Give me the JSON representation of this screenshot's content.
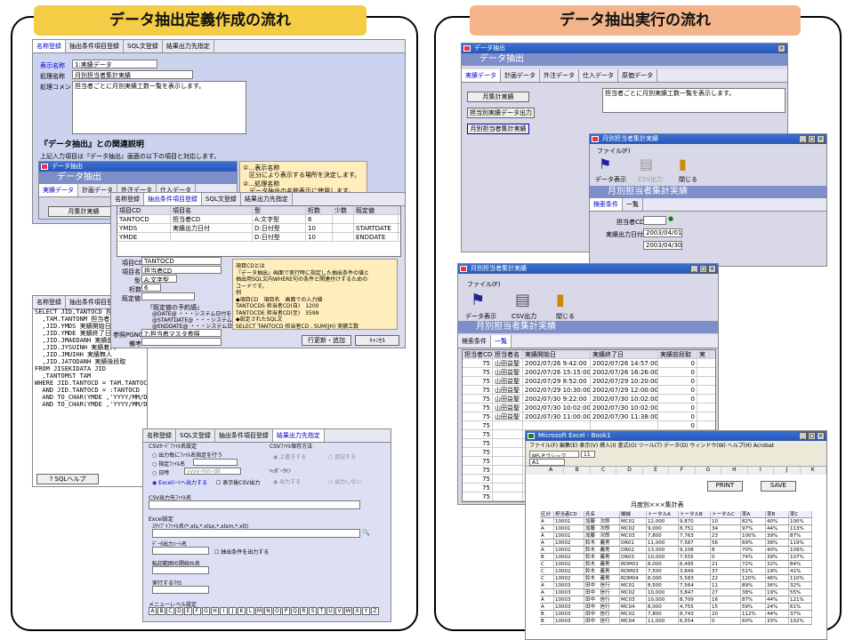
{
  "left": {
    "title": "データ抽出定義作成の流れ"
  },
  "right": {
    "title": "データ抽出実行の流れ"
  },
  "w1": {
    "tabs": [
      "名称登録",
      "抽出条件項目登録",
      "SQL文登録",
      "結果出力先指定"
    ],
    "display_label": "表示名称",
    "display_value": "1:実績データ",
    "process_label": "処理名称",
    "process_value": "月別担当者集計実績",
    "comment_label": "処理コメント",
    "comment_value": "担当者ごとに月別実績工数一覧を表示します。"
  },
  "rel": {
    "heading": "『データ抽出』との関連説明",
    "desc": "上記入力項目は『データ抽出』画面の以下の項目と対応します。",
    "mini_title": "データ抽出",
    "mini_header": "データ抽出",
    "mini_tabs": [
      "実績データ",
      "計画データ",
      "外注データ",
      "仕入データ",
      "原価データ"
    ],
    "mini_btn": "月集計実績",
    "note1": "①…表示名称",
    "note1b": "区分により表示する場所を決定します。",
    "note2": "②…処理名称",
    "note2b": "データ抽出の名称表示に使用します。"
  },
  "w2": {
    "tabs": [
      "名称登録",
      "抽出条件項目登録",
      "SQL文登録",
      "結果出力先指定"
    ],
    "cols": [
      "項目CD",
      "項目名",
      "型",
      "桁数",
      "少数",
      "既定値"
    ],
    "rows": [
      [
        "TANTOCD",
        "担当者CD",
        "A:文字型",
        "6",
        "",
        ""
      ],
      [
        "YMDS",
        "実績出力日付",
        "D:日付型",
        "10",
        "",
        "STARTDATE"
      ],
      [
        "YMDE",
        "",
        "D:日付型",
        "10",
        "",
        "ENDDATE"
      ]
    ],
    "code_label": "項目CD",
    "code_value": "TANTOCD",
    "name_label": "項目名",
    "name_value": "担当者CD",
    "type_label": "型",
    "type_value": "A:文字型",
    "digits_label": "桁数",
    "digits_value": "6",
    "default_label": "既定値",
    "hint_title": "『既定値の予約語』",
    "hint_lines": [
      "@DATE@ ・・・システム日付を表示",
      "@STARTDATE@ ・・・システム日付の月初",
      "@ENDDATE@ ・・・システム日付の月末"
    ],
    "ref_label": "参照PGNO",
    "ref_value": "7:担当者マスタ参照",
    "note_label": "備考",
    "note_lines": [
      "項目CDとは",
      "『データ抽出』画面で実行時に指定した抽出条件の値と",
      "抽出用SQL文内WHERE句の条件と関連付けするための",
      "コードです。",
      "例",
      "◆項目CD　項目名　画面での入力値",
      "TANTOCDS 担当者CD(自)　1200",
      "TANTOCDE 担当者CD(至)　3599",
      "◆設定されたSQL文",
      "SELECT TANTOCD 担当者CD , SUM(JH) 実績工数"
    ],
    "btn_add": "行更新・追加",
    "btn_cancel": "ｷｬﾝｾﾙ"
  },
  "w3": {
    "tabs": [
      "名称登録",
      "抽出条件項目登録"
    ],
    "sql": [
      "SELECT JID,TANTOCD 担当者CD",
      "  ,TAM.TANTONM 担当者名",
      "  ,JID.YMDS 実績開始日",
      "  ,JID.YMDE 実績終了日",
      "  ,JID.JMAEDANH 実績前段取",
      "  ,JID.JYSUINH 実績着入",
      "  ,JID.JMUIHH 実績無人",
      "  ,JID.JATODANH 実績後段取",
      "FROM JISEKIDATA JID",
      "  ,TANTOMST TAM",
      "WHERE JID.TANTOCD = TAM.TANTOCD (+)",
      "  AND JID.TANTOCD = :TANTOCD",
      "  AND TO_CHAR(YMDE ,'YYYY/MM/DD') >= :YMDS",
      "  AND TO_CHAR(YMDE ,'YYYY/MM/DD') <= :YMDE"
    ],
    "help": "SQLヘルプ"
  },
  "w4": {
    "tabs": [
      "名称登録",
      "SQL文登録",
      "抽出条件項目登録",
      "結果出力先指定"
    ],
    "grp1": "CSVｶｰﾄﾞﾌｧｲﾙ名設定",
    "opt1": "出力毎にﾌｧｲﾙ名指定を行う",
    "opt2": "指定ﾌｧｲﾙ名",
    "opt3": "日時",
    "date_fmt": "yyyy-mm-dd",
    "opt4": "Excelｼｰﾄへ出力する",
    "chk1": "表示後CSV出力",
    "grp2": "CSVﾌｧｲﾙ保存方法",
    "save1": "上書きする",
    "save2": "追記する",
    "grp3": "ﾍｯﾀﾞｰﾗｲﾝ",
    "hdr1": "出力する",
    "hdr2": "出力しない",
    "csv_file": "CSV出力先ﾌｧｲﾙ名",
    "excel_grp": "Excel設定",
    "excel_file": "ｽｸﾘﾌﾟﾄﾌｧｲﾙ名(*.xls,*.xlsx,*.xlsm,*.xlt)",
    "sheet": "ﾃﾞｰﾀ出力ｼｰﾄ名",
    "chk2": "抽出条件を出力する",
    "range": "転記範囲の開始ｾﾙ名",
    "macro": "実行するﾏｸﾛ",
    "menu": "メニューレベル設定",
    "letters": [
      "A",
      "B",
      "C",
      "D",
      "E",
      "F",
      "G",
      "H",
      "I",
      "J",
      "K",
      "L",
      "M",
      "N",
      "O",
      "P",
      "Q",
      "R",
      "S",
      "T",
      "U",
      "V",
      "W",
      "X",
      "Y",
      "Z"
    ]
  },
  "r1": {
    "title": "データ抽出",
    "header": "データ抽出",
    "tabs": [
      "実績データ",
      "計画データ",
      "外注データ",
      "仕入データ",
      "原価データ"
    ],
    "btns": [
      "月集計実績",
      "担当別実績データ出力",
      "月別担当者集計実績"
    ],
    "desc": "担当者ごとに月別実績工数一覧を表示します。"
  },
  "r2": {
    "title": "月別担当者集計実績",
    "menu": "ファイル(F)",
    "btns": [
      "データ表示",
      "CSV出力",
      "閉じる"
    ],
    "header": "月別担当者集計実績",
    "tabs": [
      "検索条件",
      "一覧"
    ],
    "tanto_label": "担当者CD",
    "date_label": "実績出力日付",
    "date_from": "2003/04/01",
    "date_to": "2003/04/30"
  },
  "r3": {
    "title": "月別担当者集計実績",
    "menu": "ファイル(F)",
    "btns": [
      "データ表示",
      "CSV出力",
      "閉じる"
    ],
    "header": "月別担当者集計実績",
    "tabs": [
      "検索条件",
      "一覧"
    ],
    "cols": [
      "担当者CD",
      "担当者名",
      "実績開始日",
      "実績終了日",
      "実績前段取",
      "実"
    ],
    "rows": [
      [
        "75",
        "山田益聖",
        "2002/07/26 9:42:00",
        "2002/07/26 14:57:00",
        "0"
      ],
      [
        "75",
        "山田益聖",
        "2002/07/26 15:15:00",
        "2002/07/26 16:26:00",
        "0"
      ],
      [
        "75",
        "山田益聖",
        "2002/07/29 8:52:00",
        "2002/07/29 10:20:00",
        "0"
      ],
      [
        "75",
        "山田益聖",
        "2002/07/29 10:30:00",
        "2002/07/29 12:00:00",
        "0"
      ],
      [
        "75",
        "山田益聖",
        "2002/07/30 9:22:00",
        "2002/07/30 10:02:00",
        "0"
      ],
      [
        "75",
        "山田益聖",
        "2002/07/30 10:02:00",
        "2002/07/30 10:02:00",
        "0"
      ],
      [
        "75",
        "山田益聖",
        "2002/07/30 11:00:00",
        "2002/07/30 11:38:00",
        "0"
      ],
      [
        "75",
        "",
        "",
        "",
        "0"
      ],
      [
        "75",
        "",
        "",
        "",
        "0"
      ],
      [
        "75",
        "",
        "",
        "",
        "0"
      ],
      [
        "75",
        "",
        "",
        "",
        "0"
      ],
      [
        "75",
        "",
        "",
        "",
        "0"
      ],
      [
        "75",
        "",
        "",
        "",
        "0"
      ],
      [
        "75",
        "",
        "",
        "",
        "0"
      ],
      [
        "75",
        "",
        "",
        "",
        "0"
      ],
      [
        "75",
        "",
        "",
        "",
        "0"
      ]
    ]
  },
  "excel": {
    "title": "Microsoft Excel - Book1",
    "menu": "ファイル(F) 編集(E) 表示(V) 挿入(I) 書式(O) ツール(T) データ(D) ウィンドウ(W) ヘルプ(H) Acrobat",
    "font": "MS Pゴシック",
    "size": "11",
    "cell": "A1",
    "cols": [
      "A",
      "B",
      "C",
      "D",
      "E",
      "F",
      "G",
      "H",
      "I",
      "J",
      "K"
    ],
    "print": "PRINT",
    "save": "SAVE",
    "report_title": "月度別×××集計表",
    "heads": [
      "区分",
      "担当者CD",
      "氏名",
      "機械",
      "トータルA",
      "トータルB",
      "トータルC",
      "率A",
      "率B",
      "率C"
    ],
    "rows": [
      [
        "A",
        "10001",
        "加藤　次郎",
        "MC01",
        "12,000",
        "9,870",
        "10",
        "82%",
        "40%",
        "100%"
      ],
      [
        "A",
        "10001",
        "加藤　次郎",
        "MC02",
        "9,000",
        "8,751",
        "34",
        "97%",
        "44%",
        "113%"
      ],
      [
        "A",
        "10001",
        "加藤　次郎",
        "MC03",
        "7,800",
        "7,763",
        "23",
        "100%",
        "39%",
        "87%"
      ],
      [
        "A",
        "10002",
        "鈴木　義男",
        "DR01",
        "11,000",
        "7,587",
        "56",
        "69%",
        "38%",
        "119%"
      ],
      [
        "A",
        "10002",
        "鈴木　義男",
        "DR02",
        "13,000",
        "9,108",
        "8",
        "70%",
        "40%",
        "109%"
      ],
      [
        "B",
        "10002",
        "鈴木　義男",
        "DR03",
        "10,000",
        "7,555",
        "0",
        "74%",
        "39%",
        "107%"
      ],
      [
        "C",
        "10002",
        "鈴木　義男",
        "RDM02",
        "8,000",
        "6,495",
        "21",
        "72%",
        "32%",
        "84%"
      ],
      [
        "C",
        "10002",
        "鈴木　義男",
        "RDM03",
        "7,500",
        "3,849",
        "37",
        "51%",
        "19%",
        "41%"
      ],
      [
        "C",
        "10002",
        "鈴木　義男",
        "RDM04",
        "8,000",
        "5,583",
        "22",
        "120%",
        "46%",
        "110%"
      ],
      [
        "A",
        "10003",
        "田中　信行",
        "MC01",
        "8,500",
        "7,564",
        "11",
        "89%",
        "36%",
        "32%"
      ],
      [
        "A",
        "10003",
        "田中　信行",
        "MC02",
        "10,000",
        "3,847",
        "27",
        "38%",
        "19%",
        "55%"
      ],
      [
        "A",
        "10003",
        "田中　信行",
        "MC03",
        "10,000",
        "8,709",
        "16",
        "87%",
        "44%",
        "121%"
      ],
      [
        "A",
        "10003",
        "田中　信行",
        "MC04",
        "8,000",
        "4,755",
        "15",
        "59%",
        "24%",
        "61%"
      ],
      [
        "B",
        "10003",
        "田中　信行",
        "MC02",
        "7,800",
        "8,743",
        "20",
        "112%",
        "44%",
        "37%"
      ],
      [
        "B",
        "10003",
        "田中　信行",
        "MC04",
        "11,000",
        "6,554",
        "0",
        "60%",
        "33%",
        "102%"
      ]
    ]
  }
}
